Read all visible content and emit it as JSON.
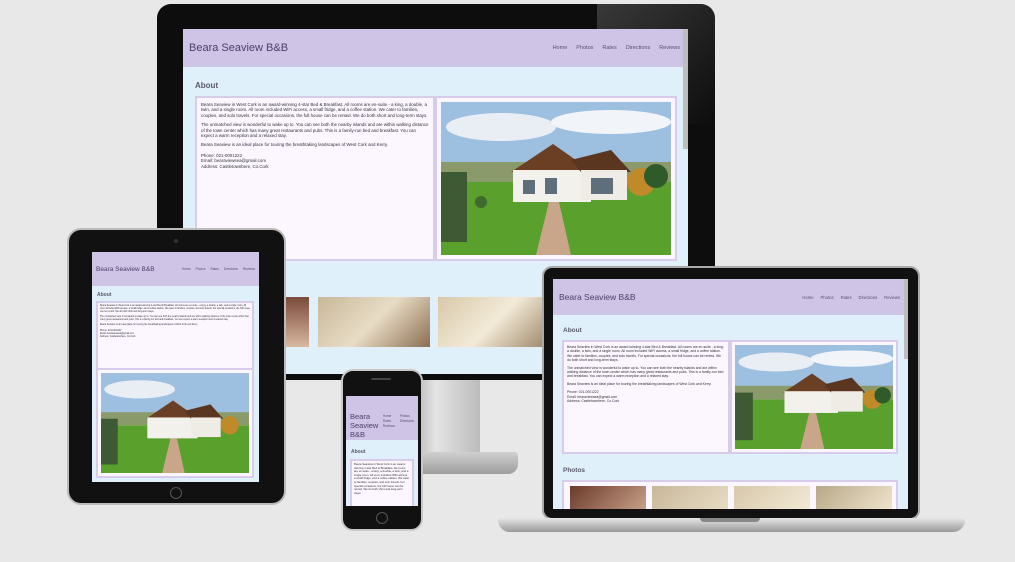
{
  "site": {
    "brand": "Beara Seaview B&B",
    "nav": [
      "Home",
      "Photos",
      "Rates",
      "Directions",
      "Reviews"
    ],
    "about_heading": "About",
    "photos_heading": "Photos",
    "para1": "Beara Seaview in West Cork is an award-winning 4-star Bed & Breakfast. All rooms are en-suite - a king, a double, a twin, and a single room. All room included WiFi access, a small fridge, and a coffee station. We cater to families, couples, and solo travels. For special occasions, the full house can be rented. We do both short and long-term stays.",
    "para2": "The unmatched view is wonderful to wake up to. You can see both the nearby islands and are within walking distance of the town center which has many great restaurants and pubs. This is a family-run bed and breakfast. You can expect a warm reception and a relaxed stay.",
    "para3": "Beara Seaview is an ideal place for touring the breathtaking landscapes of West Cork and Kerry.",
    "phone": "Phone: 021-0001222",
    "email": "Email: bearaviewsea@gmail.com",
    "address": "Address: Castletownbere, Co.Cork"
  },
  "colors": {
    "header": "#cfc3e6",
    "page": "#dff0fb",
    "box_border": "#d7cdea"
  }
}
